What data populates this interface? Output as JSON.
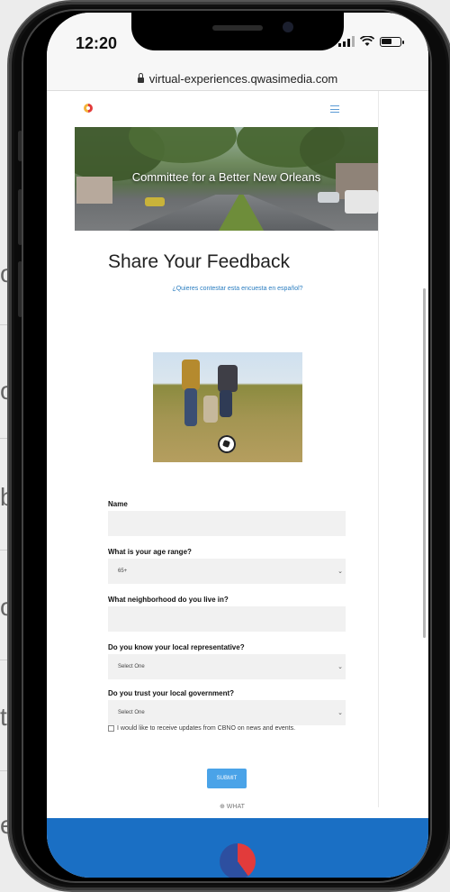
{
  "status_bar": {
    "time": "12:20"
  },
  "browser": {
    "url": "virtual-experiences.qwasimedia.com"
  },
  "site": {
    "hero_title": "Committee for a Better New Orleans",
    "page_title": "Share Your Feedback",
    "spanish_link": "¿Quieres contestar esta encuesta en español?"
  },
  "form": {
    "name_label": "Name",
    "age_label": "What is your age range?",
    "age_value": "65+",
    "neighborhood_label": "What neighborhood do you live in?",
    "rep_label": "Do you know your local representative?",
    "rep_value": "Select One",
    "trust_label": "Do you trust your local government?",
    "trust_value": "Select One",
    "updates_label": "I would like to receive updates from CBNO on news and events.",
    "submit_label": "SUBMIT"
  },
  "peek_text": "⊕ WHAT",
  "icons": {
    "menu": "hamburger-menu-icon",
    "lock": "lock-icon",
    "chevron": "chevron-down-icon"
  },
  "colors": {
    "accent": "#4aa3e8",
    "link": "#2a7dc0",
    "footer": "#1a6fc4"
  }
}
